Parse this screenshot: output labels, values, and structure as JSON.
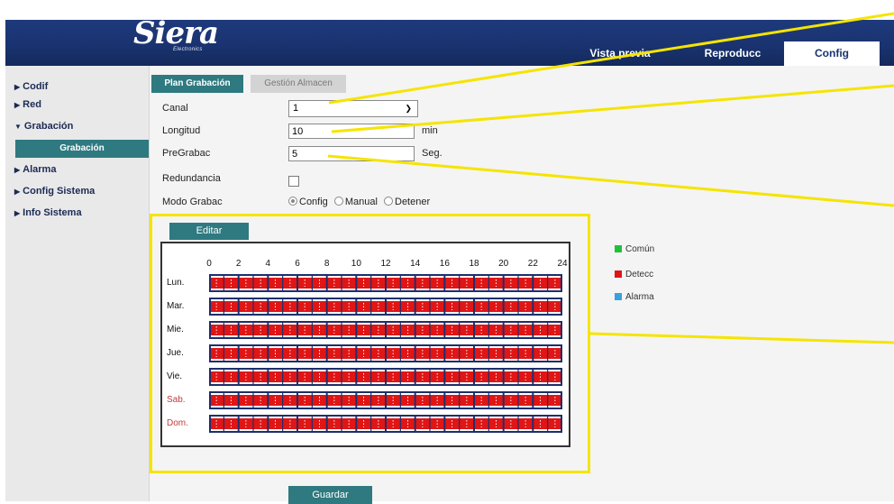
{
  "brand": {
    "logo": "Siera",
    "tagline": "Electronics"
  },
  "nav": {
    "preview": "Vista previa",
    "playback": "Reproducc",
    "config": "Config"
  },
  "sidebar": {
    "items": [
      {
        "label": "Codif",
        "expanded": false
      },
      {
        "label": "Red",
        "expanded": false
      },
      {
        "label": "Grabación",
        "expanded": true
      },
      {
        "label": "Alarma",
        "expanded": false
      },
      {
        "label": "Config Sistema",
        "expanded": false
      },
      {
        "label": "Info Sistema",
        "expanded": false
      }
    ],
    "active_sub": "Grabación"
  },
  "subtabs": {
    "plan": "Plan Grabación",
    "storage": "Gestión Almacen"
  },
  "form": {
    "canal_label": "Canal",
    "canal_value": "1",
    "longitud_label": "Longitud",
    "longitud_value": "10",
    "longitud_unit": "min",
    "pregrabac_label": "PreGrabac",
    "pregrabac_value": "5",
    "pregrabac_unit": "Seg.",
    "redundancia_label": "Redundancia",
    "redundancia_checked": false,
    "modo_label": "Modo Grabac",
    "modo_options": [
      "Config",
      "Manual",
      "Detener"
    ],
    "modo_selected": "Config"
  },
  "schedule": {
    "edit_label": "Editar",
    "hours": [
      "0",
      "2",
      "4",
      "6",
      "8",
      "10",
      "12",
      "14",
      "16",
      "18",
      "20",
      "22",
      "24"
    ],
    "days": [
      "Lun.",
      "Mar.",
      "Mie.",
      "Jue.",
      "Vie.",
      "Sab.",
      "Dom."
    ],
    "weekend_days": [
      "Sab.",
      "Dom."
    ],
    "recording_type_all_day": "Detecc",
    "legend": [
      {
        "label": "Común",
        "color": "#22c03a"
      },
      {
        "label": "Detecc",
        "color": "#e01515"
      },
      {
        "label": "Alarma",
        "color": "#3aa0e0"
      }
    ]
  },
  "save_label": "Guardar",
  "colors": {
    "header": "#1a3370",
    "accent": "#2e7a80",
    "highlight": "#f5e400",
    "grid_line": "#1d2f6b"
  }
}
